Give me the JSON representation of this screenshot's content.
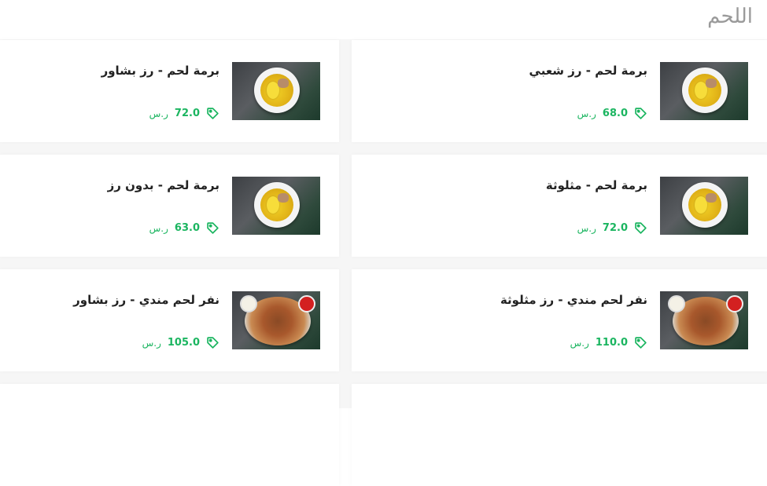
{
  "section": {
    "title": "اللحم"
  },
  "colors": {
    "accent": "#1bb560",
    "title": "#9a9a9a"
  },
  "items": [
    {
      "name": "برمة لحم - رز شعبي",
      "price": "68.0",
      "currency": "ر.س",
      "image": "bowl"
    },
    {
      "name": "برمة لحم - رز بشاور",
      "price": "72.0",
      "currency": "ر.س",
      "image": "bowl"
    },
    {
      "name": "برمة لحم - مثلوثة",
      "price": "72.0",
      "currency": "ر.س",
      "image": "bowl"
    },
    {
      "name": "برمة لحم - بدون رز",
      "price": "63.0",
      "currency": "ر.س",
      "image": "bowl"
    },
    {
      "name": "نفر لحم مندي - رز مثلوثة",
      "price": "110.0",
      "currency": "ر.س",
      "image": "platter"
    },
    {
      "name": "نفر لحم مندي - رز بشاور",
      "price": "105.0",
      "currency": "ر.س",
      "image": "platter"
    }
  ],
  "icons": {
    "price": "price-tag-icon"
  }
}
